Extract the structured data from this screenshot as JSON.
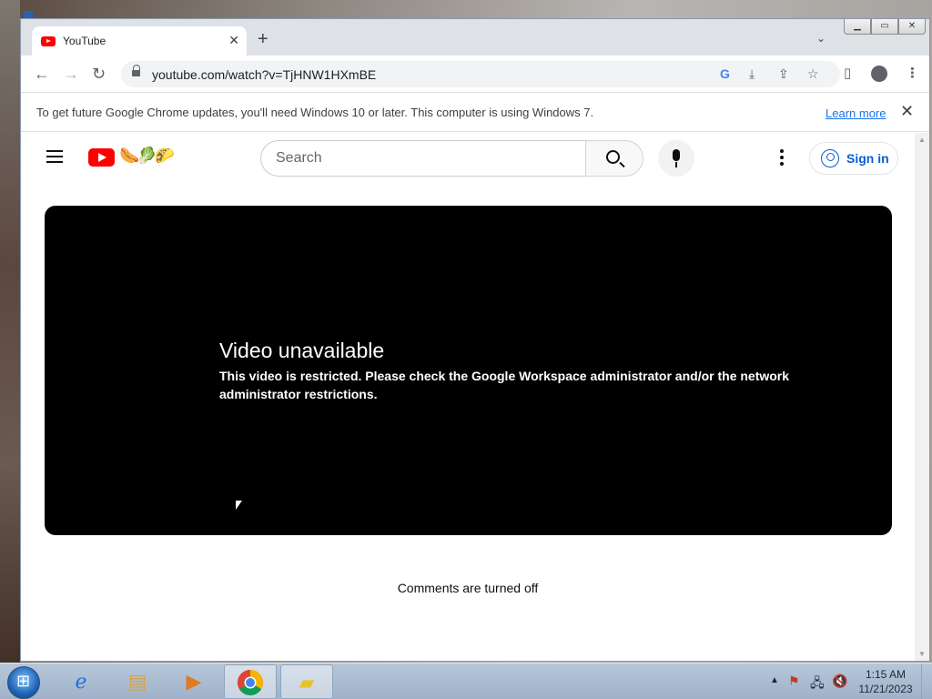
{
  "browser": {
    "tab": {
      "title": "YouTube"
    },
    "url": "youtube.com/watch?v=TjHNW1HXmBE",
    "infobar": {
      "message": "To get future Google Chrome updates, you'll need Windows 10 or later. This computer is using Windows 7.",
      "learn_more": "Learn more"
    },
    "icons": [
      "back-icon",
      "forward-icon",
      "reload-icon",
      "lock-icon",
      "google-lens-icon",
      "install-icon",
      "share-icon",
      "bookmark-star-icon",
      "side-panel-icon",
      "profile-icon",
      "menu-icon"
    ]
  },
  "youtube": {
    "search": {
      "placeholder": "Search"
    },
    "sign_in": "Sign in",
    "player": {
      "heading": "Video unavailable",
      "message": "This video is restricted. Please check the Google Workspace administrator and/or the network administrator restrictions."
    },
    "comments": "Comments are turned off",
    "brand_color": "#ff0000",
    "link_color": "#065fd4"
  },
  "taskbar": {
    "apps": [
      "internet-explorer",
      "file-explorer",
      "media-player",
      "chrome",
      "sticky-notes"
    ],
    "clock": {
      "time": "1:15 AM",
      "date": "11/21/2023"
    }
  }
}
